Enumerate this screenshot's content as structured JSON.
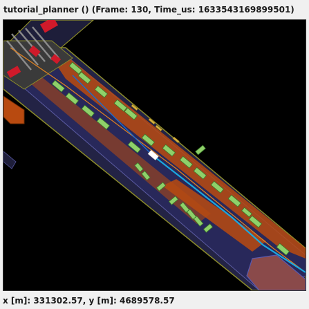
{
  "window": {
    "app_name": "tutorial_planner",
    "title_suffix": "()",
    "frame_label": "Frame:",
    "frame_value": "130",
    "time_label": "Time_us:",
    "time_value": "1633543169899501",
    "title": "tutorial_planner () (Frame: 130, Time_us: 1633543169899501)"
  },
  "status": {
    "x_label": "x [m]:",
    "x_value": "331302.57",
    "y_label": "y [m]:",
    "y_value": "4689578.57"
  },
  "colors": {
    "background": "#000000",
    "road_border": "#8a8a2a",
    "lane_fill": "#2a2a55",
    "sidewalk": "#b84a10",
    "vehicle_fill": "#8fd06a",
    "vehicle_outline": "#3a7a2a",
    "pedestrian": "#d4b040",
    "ego_vehicle": "#ffffff",
    "planned_path": "#1aa8e0",
    "route_line": "#e08020",
    "crosswalk": "#9a9a9a",
    "stop_marker": "#d01a2a",
    "building": "#8a4a4a"
  },
  "legend_icons": [
    "ego-vehicle-icon",
    "agent-vehicle-icon",
    "pedestrian-icon",
    "planned-path-icon"
  ]
}
